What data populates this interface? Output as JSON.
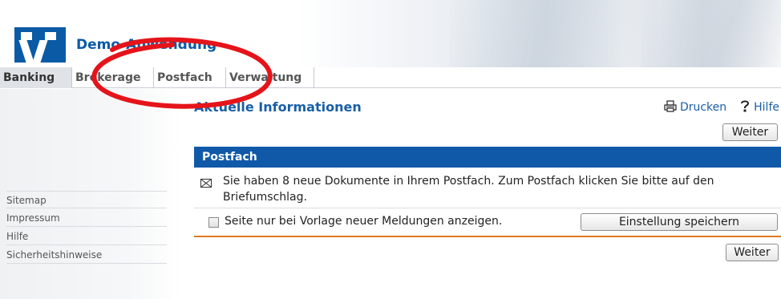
{
  "header": {
    "app_title": "Demo-Anwendung",
    "brand_color": "#0a5aa6"
  },
  "tabs": [
    {
      "label": "Banking",
      "active": true
    },
    {
      "label": "Brokerage",
      "active": false
    },
    {
      "label": "Postfach",
      "active": false
    },
    {
      "label": "Verwaltung",
      "active": false
    }
  ],
  "sidebar": {
    "links": [
      "Sitemap",
      "Impressum",
      "Hilfe",
      "Sicherheitshinweise"
    ]
  },
  "main": {
    "title": "Aktuelle Informationen",
    "print_label": "Drucken",
    "help_label": "Hilfe",
    "next_label_top": "Weiter",
    "next_label_bottom": "Weiter",
    "panel": {
      "title": "Postfach",
      "message": "Sie haben 8 neue Dokumente in Ihrem Postfach. Zum Postfach klicken Sie bitte auf den Briefumschlag.",
      "option_label": "Seite nur bei Vorlage neuer Meldungen anzeigen.",
      "option_checked": false,
      "save_label": "Einstellung speichern"
    }
  },
  "icons": {
    "print": "printer-icon",
    "help": "help-icon",
    "message": "envelope-icon"
  },
  "colors": {
    "panel_header": "#1059a8",
    "link": "#1a5fa6",
    "separator": "#e07a1f",
    "annotation": "#e5141a"
  }
}
